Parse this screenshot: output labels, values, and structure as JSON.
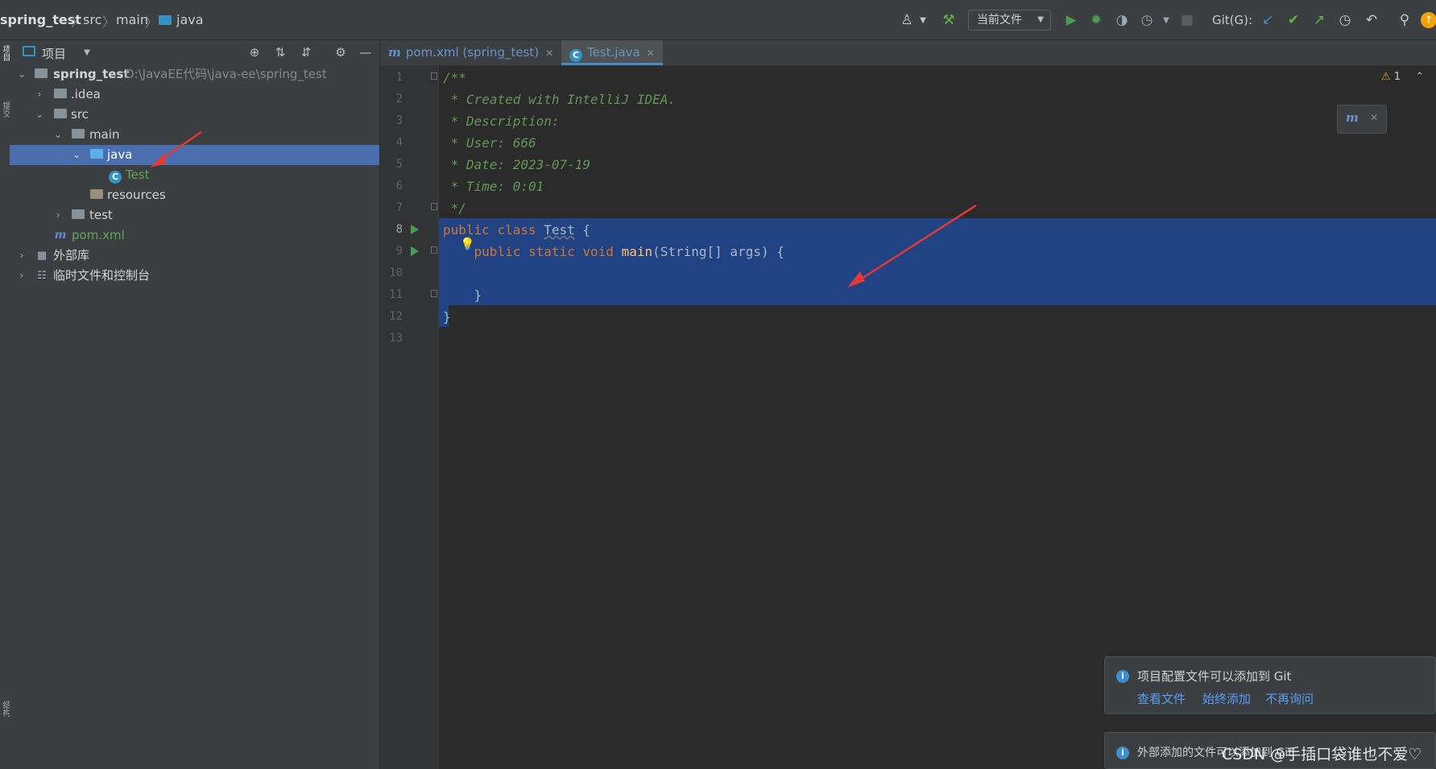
{
  "breadcrumb": {
    "items": [
      "spring_test",
      "src",
      "main",
      "java"
    ],
    "separator": "〉"
  },
  "toolbar": {
    "run_config_label": "当前文件",
    "git_label": "Git(G):"
  },
  "left_strip": {
    "tab_top": "项目",
    "tab_mid": "提交",
    "tab_bottom": "结构"
  },
  "project_panel": {
    "title": "项目",
    "tree": [
      {
        "label": "spring_test",
        "path": "D:\\JavaEE代码\\java-ee\\spring_test",
        "bold": true
      },
      {
        "label": ".idea"
      },
      {
        "label": "src"
      },
      {
        "label": "main"
      },
      {
        "label": "java",
        "selected": true
      },
      {
        "label": "Test"
      },
      {
        "label": "resources"
      },
      {
        "label": "test"
      },
      {
        "label": "pom.xml"
      },
      {
        "label": "外部库"
      },
      {
        "label": "临时文件和控制台"
      }
    ]
  },
  "editor": {
    "tabs": [
      {
        "label": "pom.xml (spring_test)",
        "icon": "m"
      },
      {
        "label": "Test.java",
        "icon": "c",
        "active": true
      }
    ],
    "line_numbers": [
      "1",
      "2",
      "3",
      "4",
      "5",
      "6",
      "7",
      "8",
      "9",
      "10",
      "11",
      "12",
      "13"
    ],
    "code": [
      "/**",
      " * Created with IntelliJ IDEA.",
      " * Description:",
      " * User: 666",
      " * Date: 2023-07-19",
      " * Time: 0:01",
      " */",
      "public class Test {",
      "    public static void main(String[] args) {",
      "",
      "    }",
      "}",
      ""
    ],
    "code_tokens": {
      "l8_kw": "public class ",
      "l8_name": "Test",
      "l8_rest": " {",
      "l9_kw": "public static void ",
      "l9_fn": "main",
      "l9_rest": "(String[] args) {",
      "l11": "}",
      "l12": "}"
    },
    "warning_count": "1"
  },
  "notifications": [
    {
      "message": "项目配置文件可以添加到 Git",
      "links": [
        "查看文件",
        "始终添加",
        "不再询问"
      ]
    },
    {
      "message": "外部添加的文件可以添加到 Git"
    }
  ],
  "watermark": "CSDN @手插口袋谁也不爱♡",
  "colors": {
    "selection": "#4b6eaf",
    "code_selection": "#214283",
    "comment": "#629755",
    "keyword": "#cc7832",
    "function": "#ffc66d",
    "link": "#589df6",
    "run_green": "#499c54",
    "arrow_red": "#e53935"
  }
}
